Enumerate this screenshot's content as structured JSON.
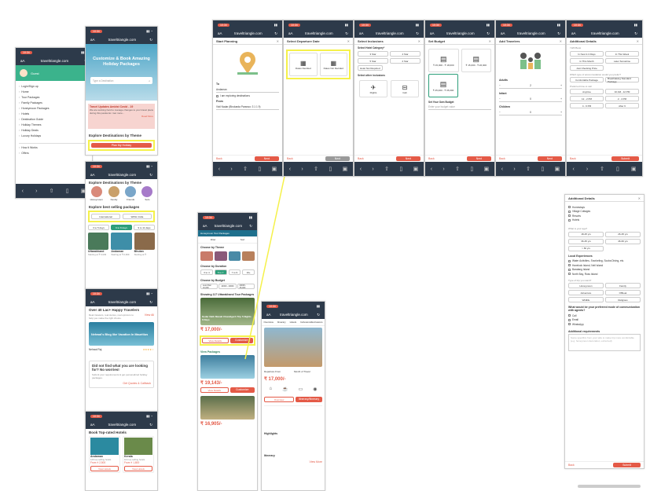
{
  "status_time": "10:34",
  "url_host": "traveltriangle.com",
  "menu_screen": {
    "user": "Guest",
    "items": [
      "Login/Sign up",
      "Home",
      "Tour Packages",
      "Family Packages",
      "Honeymoon Packages",
      "Hotels",
      "Destination Guide",
      "Holiday Themes",
      "Holiday Deals",
      "Luxury Holidays"
    ],
    "footer": [
      "How it Works",
      "Offers"
    ]
  },
  "home_screen": {
    "hero_title": "Customize & Book Amazing Holiday Packages",
    "search_placeholder": "Type a Destination",
    "alert_title": "Travel Updates Amidst Covid - 19",
    "alert_body": "We are working hard to manage changes to your travel plans during this pandemic. Get more...",
    "alert_link": "Read More",
    "themes_title": "Explore Destinations by Theme",
    "plan_button": "Plan My Holiday"
  },
  "themes_screen": {
    "title": "Explore Destinations by Theme",
    "themes": [
      "Honeymoon",
      "Family",
      "Friends",
      "Solo"
    ],
    "bestselling_title": "Explore best selling packages",
    "pills": [
      "International",
      "Within India"
    ],
    "durations": [
      "3 to 5 days",
      "6 to 8 days",
      "9 to 11 days"
    ],
    "cards": [
      {
        "name": "Uttarakhand",
        "price": "Starting at ₹ 6,949"
      },
      {
        "name": "Andaman",
        "price": "Starting at ₹ 6,999"
      },
      {
        "name": "Bhutan",
        "price": "Starting at ₹"
      }
    ]
  },
  "travelers_screen": {
    "title": "Over 40 Lac+ Happy Travelers",
    "subtitle": "Real travelers, real stories, real opinions to help you make the right choice.",
    "view_all": "View All",
    "review_title": "Nehwal's Blog like Vacation In Mauritius",
    "reviewer": "Nehwal Raj",
    "nudge_title": "Did not find what you are looking for? No worries!",
    "nudge_body": "Submit your requirements & get personalized holiday packages.",
    "nudge_cta": "Get Quotes & Callback"
  },
  "hotels_screen": {
    "title": "Book Top-rated Hotels",
    "hotels": [
      {
        "name": "Andaman",
        "meta": "129 top selling hotels",
        "price": "From ₹ 2,500"
      },
      {
        "name": "Kerala",
        "meta": "104 top selling hotels",
        "price": "From ₹ 1,800"
      }
    ],
    "view_button": "View Hotels"
  },
  "listing_screen": {
    "breadcrumb": "Honeymoon Tour Packages",
    "filter": "Filter",
    "sort": "Sort",
    "by_theme": "Choose by Theme",
    "by_duration": "Choose by Duration",
    "durations": [
      "3 to 4",
      "5 to 7",
      "7 to 9",
      "10+"
    ],
    "by_budget": "Choose by Budget",
    "budgets": [
      "Less than 10,000",
      "10000 - 20000",
      "20000 - 25,000"
    ],
    "showing": "Showing 117 Uttarakhand Tour Packages",
    "pkg_title": "Kedar Nath Manali Chandigarh Trip 5 Nights 6 Days",
    "pkg_price": "₹ 17,000/-",
    "view_details": "View Details",
    "customize": "Customize",
    "view_packages": "View Packages",
    "pkg2_price": "₹ 19,143/-",
    "pkg3_price": "₹ 16,905/-"
  },
  "detail_screen": {
    "tabs": [
      "Overview",
      "Itinerary",
      "Hotels",
      "Inclusions/Exclusions"
    ],
    "departure_from": "Departure From",
    "month": "Month of Travel",
    "price": "₹ 17,000/-",
    "overview_btn": "Overview",
    "itinerary_btn": "Itinerary/Itinerary",
    "highlights": "Highlights",
    "itinerary_title": "Itinerary",
    "view_more": "View More"
  },
  "step_start": {
    "title": "Start Planning",
    "to_label": "To",
    "to_value": "Andaman",
    "inc_dest": "I am exploring destinations",
    "from_label": "From",
    "from_value": "Vizil Nadar (Bhokarda Paranoo: 3 1 1 9)",
    "back": "Back",
    "next": "Next"
  },
  "step_departure": {
    "title": "Select Departure Date",
    "opt1": "Dates Decided",
    "opt2": "Dates Not Decided",
    "back": "Back",
    "next": "Next"
  },
  "step_inclusions": {
    "title": "Select Inclusions",
    "hotel_cat": "Select Hotel Category*",
    "stars": [
      "3 Star",
      "4 Star",
      "5 Star",
      "2 Star"
    ],
    "not_required": "Hotel Not Required",
    "other": "Select other inclusions",
    "flights": "Flights",
    "cab": "Cab",
    "back": "Back",
    "next": "Next"
  },
  "step_budget": {
    "title": "Set Budget",
    "cards": [
      "₹ 15,000 - ₹ 18,000",
      "₹ 15,000 - ₹ 26,000",
      "₹ 25,000 - ₹ 35,000"
    ],
    "own": "Set Your Own Budget",
    "own_placeholder": "Enter your budget value",
    "back": "Back",
    "next": "Next"
  },
  "step_travelers": {
    "title": "Add Travelers",
    "adults": "Adults",
    "infant": "Infant",
    "children": "Children",
    "adults_val": "2",
    "infant_val": "0",
    "children_val": "0",
    "back": "Back",
    "next": "Next"
  },
  "step_details": {
    "title": "Additional Details",
    "book_q": "I Will Book",
    "book_opts": [
      "In Next 2-3 Days",
      "In This Week",
      "In This Month",
      "Later Sometime",
      "Just Checking Price"
    ],
    "hotel_q": "Which type of accommodation would you prefer?",
    "hotel_opts": [
      "Comfortable Package",
      "Breathtaking Standard Package"
    ],
    "time_q": "Preferred time to call",
    "time_opts": [
      "Anytime",
      "10 AM - 12 PM",
      "12 - 2 PM",
      "2 - 4 PM",
      "4 - 6 PM",
      "After 6"
    ],
    "back": "Back",
    "submit": "Submit"
  },
  "step_details2": {
    "title": "Additional Details",
    "stay": [
      "Homestays",
      "Village Cottages",
      "Resorts",
      "Hotels"
    ],
    "time_q": "What is your age?",
    "times": [
      "18-25 yrs",
      "26-35 yrs",
      "36-45 yrs",
      "46-60 yrs",
      "> 60 yrs"
    ],
    "local_q": "Local Experiences",
    "locals": [
      "Water Activities- Snorkeling, Scuba Diving, etc.",
      "Havelock Island, Neil Island",
      "Baratang Island",
      "North Bay, Ross Island"
    ],
    "trip_q": "Type of trip you want?",
    "trips": [
      "Honeymoon",
      "Family",
      "Adventure",
      "Offbeat",
      "Wildlife",
      "Religious"
    ],
    "comm_q": "What would be your preferred mode of communication with agents?",
    "comm": [
      "Call",
      "Email",
      "WhatsApp"
    ],
    "req_q": "Additional requirements",
    "req_placeholder": "Some specifics from your side to make trip more comfortable (e.g. honeymoon decoration, extra bed)",
    "back": "Back",
    "submit": "Submit"
  },
  "colors": {
    "accent": "#e45a47",
    "dark": "#2d3a4a",
    "highlight": "#f5f14a"
  }
}
